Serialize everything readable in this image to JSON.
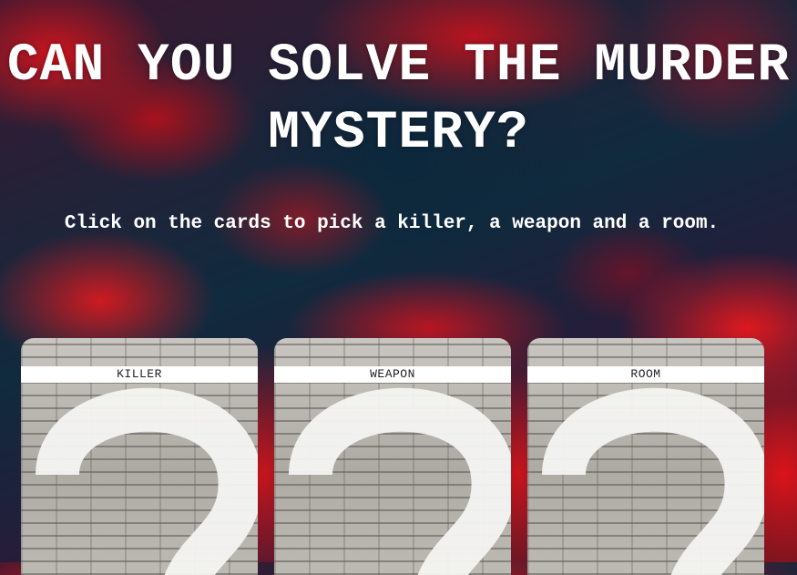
{
  "page": {
    "heading": "CAN YOU SOLVE THE MURDER MYSTERY?",
    "instruction": "Click on the cards to pick a killer, a weapon and a room."
  },
  "cards": [
    {
      "label": "KILLER",
      "icon": "question-mark-icon"
    },
    {
      "label": "WEAPON",
      "icon": "question-mark-icon"
    },
    {
      "label": "ROOM",
      "icon": "question-mark-icon"
    }
  ],
  "colors": {
    "text": "#ffffff",
    "card_label_bg": "#ffffff",
    "card_label_text": "#222222",
    "marble_red": "#d6141c",
    "marble_navy": "#0d2a3c"
  }
}
